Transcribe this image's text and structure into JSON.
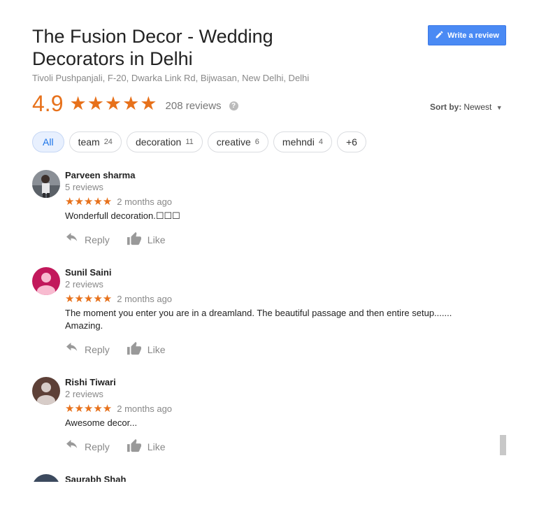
{
  "header": {
    "title": "The Fusion Decor - Wedding Decorators in Delhi",
    "address": "Tivoli Pushpanjali, F-20, Dwarka Link Rd, Bijwasan, New Delhi, Delhi",
    "write_review_label": "Write a review"
  },
  "rating": {
    "value": "4.9",
    "stars": "★★★★★",
    "reviews_count": "208 reviews",
    "help": "?"
  },
  "sort": {
    "label": "Sort by:",
    "value": "Newest"
  },
  "chips": [
    {
      "label": "All",
      "count": ""
    },
    {
      "label": "team",
      "count": "24"
    },
    {
      "label": "decoration",
      "count": "11"
    },
    {
      "label": "creative",
      "count": "6"
    },
    {
      "label": "mehndi",
      "count": "4"
    },
    {
      "label": "+6",
      "count": ""
    }
  ],
  "actions": {
    "reply": "Reply",
    "like": "Like"
  },
  "reviews": [
    {
      "name": "Parveen sharma",
      "sub": "5 reviews",
      "stars": "★★★★★",
      "date": "2 months ago",
      "text": "Wonderfull decoration.☐☐☐"
    },
    {
      "name": "Sunil Saini",
      "sub": "2 reviews",
      "stars": "★★★★★",
      "date": "2 months ago",
      "text": "The moment you enter you are in a dreamland. The beautiful passage and then entire setup....... Amazing."
    },
    {
      "name": "Rishi Tiwari",
      "sub": "2 reviews",
      "stars": "★★★★★",
      "date": "2 months ago",
      "text": "Awesome decor..."
    },
    {
      "name": "Saurabh Shah"
    }
  ],
  "colors": {
    "accent": "#e7711b",
    "button": "#4a8af4",
    "avatar_sunil": "#c2185b",
    "avatar_rishi": "#5d4037"
  }
}
